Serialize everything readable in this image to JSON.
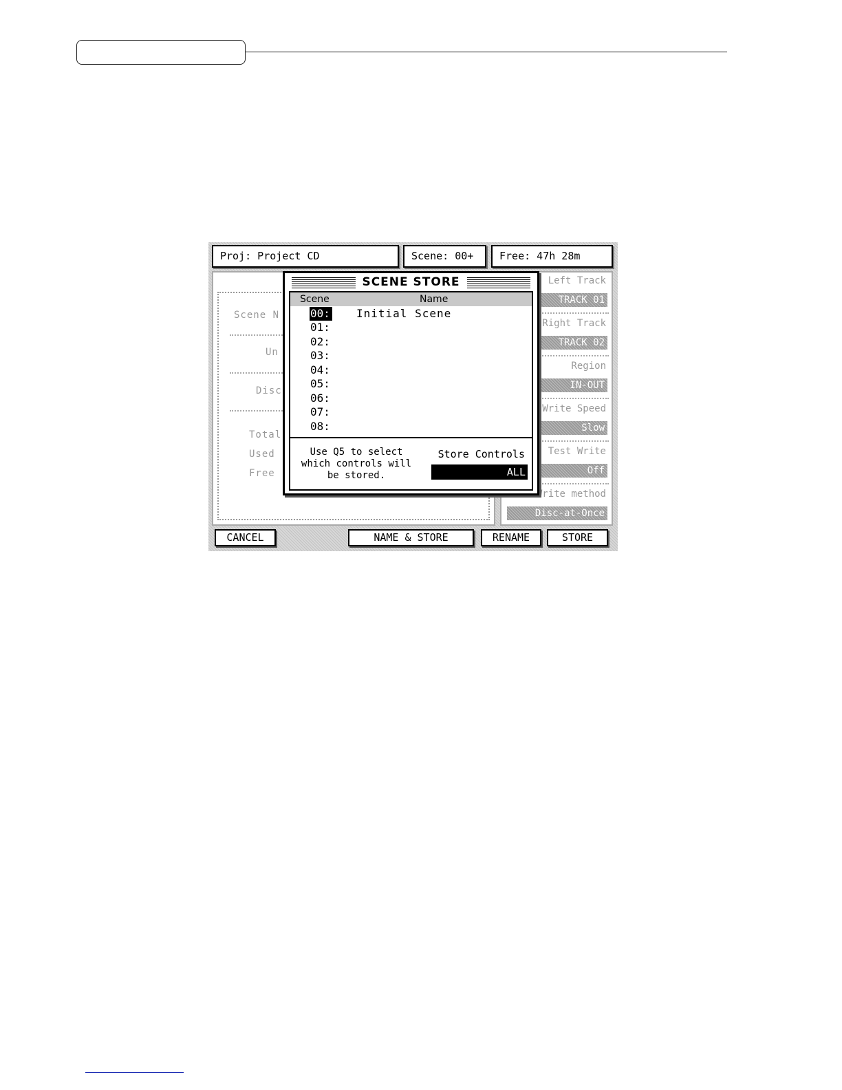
{
  "lcd": {
    "status": {
      "project": "Proj: Project CD",
      "scene": "Scene: 00+",
      "free": "Free: 47h 28m"
    },
    "background_left_labels": [
      "Scene N",
      "Un",
      "Disc",
      "Total",
      "Used",
      "Free"
    ],
    "background_right": [
      {
        "label": "Left Track",
        "value": "TRACK 01"
      },
      {
        "label": "Right Track",
        "value": "TRACK 02"
      },
      {
        "label": "Region",
        "value": "IN-OUT"
      },
      {
        "label": "Write Speed",
        "value": "Slow"
      },
      {
        "label": "Test Write",
        "value": "Off"
      },
      {
        "label": "Write method",
        "value": "Disc-at-Once"
      }
    ],
    "dialog": {
      "title": "SCENE STORE",
      "column_scene": "Scene",
      "column_name": "Name",
      "scenes": [
        {
          "num": "00:",
          "name": "Initial Scene",
          "selected": true
        },
        {
          "num": "01:",
          "name": ""
        },
        {
          "num": "02:",
          "name": ""
        },
        {
          "num": "03:",
          "name": ""
        },
        {
          "num": "04:",
          "name": ""
        },
        {
          "num": "05:",
          "name": ""
        },
        {
          "num": "06:",
          "name": ""
        },
        {
          "num": "07:",
          "name": ""
        },
        {
          "num": "08:",
          "name": ""
        }
      ],
      "help_text": [
        "Use Q5 to select",
        "which controls will",
        "be stored."
      ],
      "store_controls_label": "Store Controls",
      "store_controls_value": "ALL"
    },
    "softkeys": {
      "cancel": "CANCEL",
      "name_store": "NAME & STORE",
      "rename": "RENAME",
      "store": "STORE"
    }
  }
}
